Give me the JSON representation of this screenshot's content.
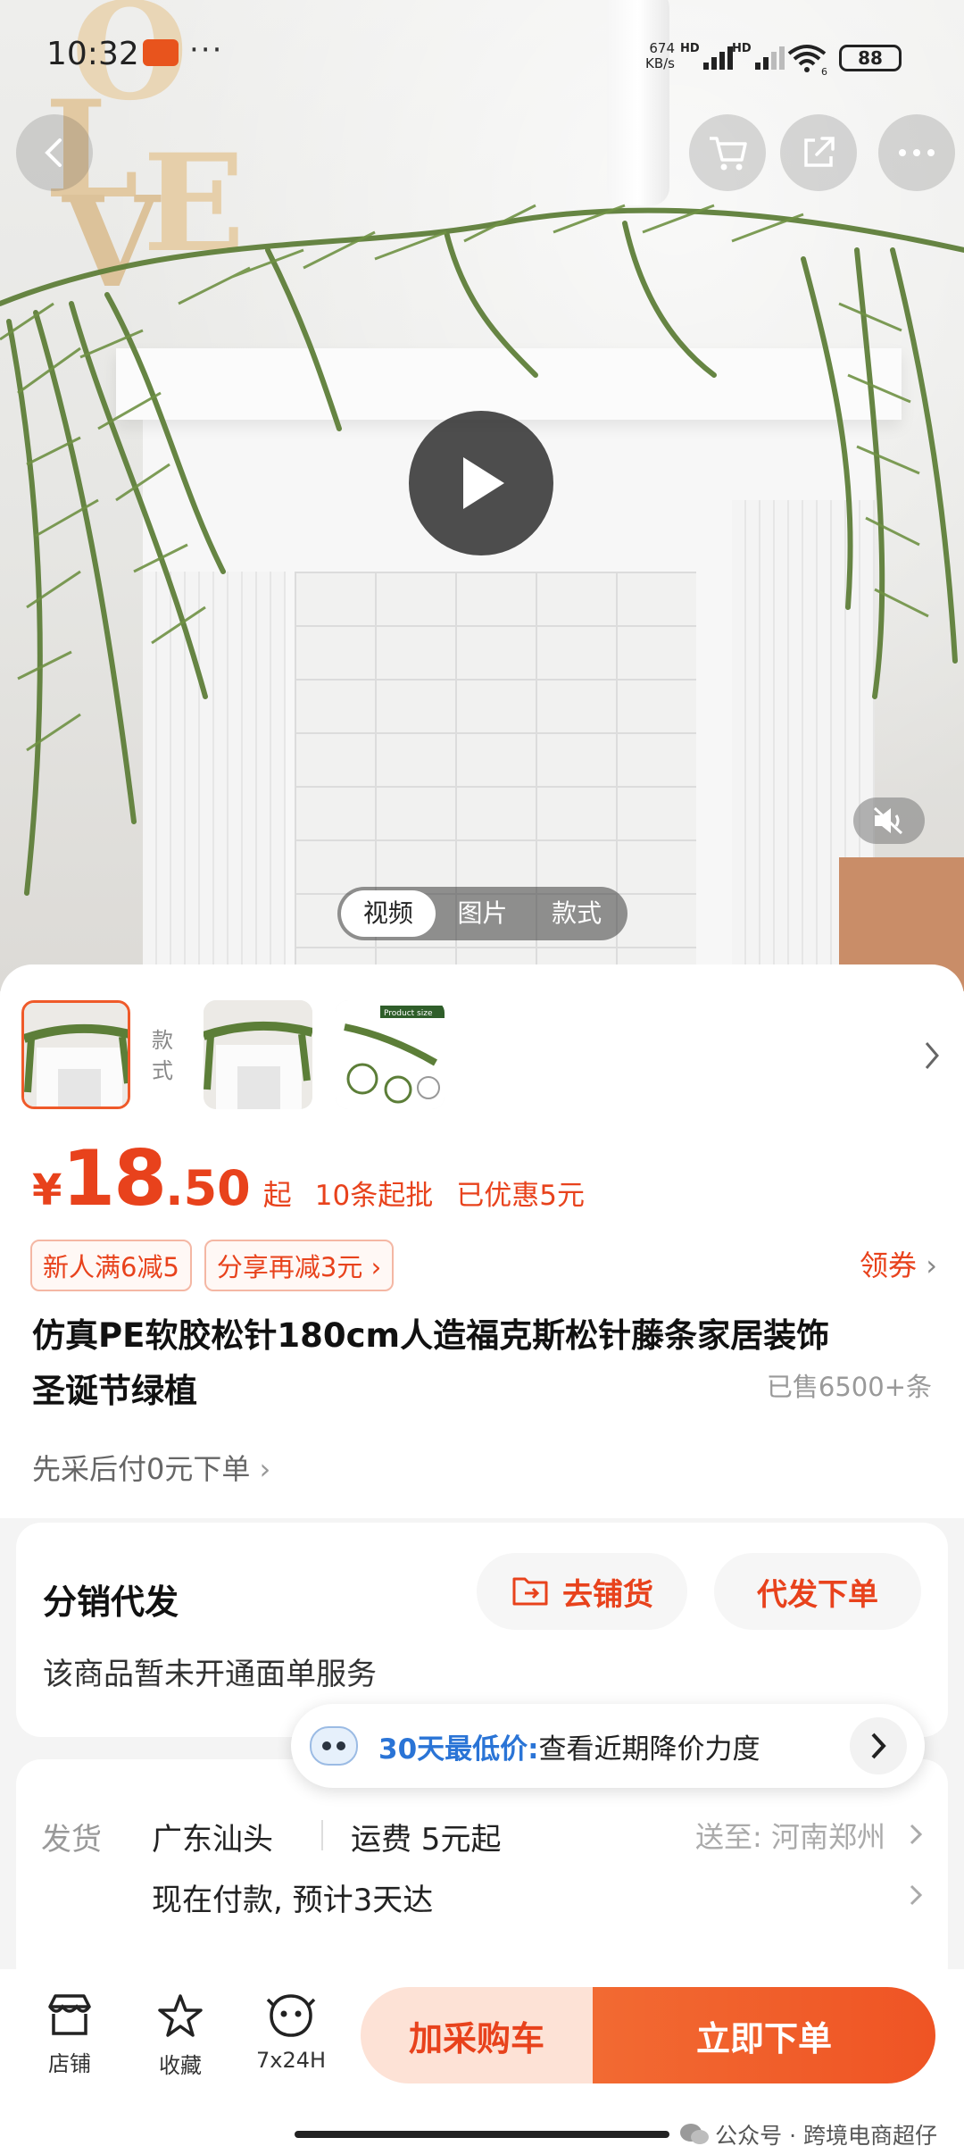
{
  "status_bar": {
    "time": "10:32",
    "more": "···",
    "net_speed_value": "674",
    "net_speed_unit": "KB/s",
    "sig1_label": "HD",
    "sig2_label": "HD",
    "sim_index": "6",
    "battery": "88"
  },
  "media": {
    "tabs": [
      "视频",
      "图片",
      "款式"
    ],
    "active_tab": "视频"
  },
  "thumbs": {
    "style_label": "款式",
    "product_size_text": "Product size"
  },
  "price": {
    "currency": "¥",
    "integer": "18",
    "decimal": ".50",
    "suffix": "起",
    "min_order": "10条起批",
    "discount": "已优惠5元"
  },
  "promo_tags": [
    "新人满6减5",
    "分享再减3元"
  ],
  "coupon_link": "领券",
  "title_line1": "仿真PE软胶松针180cm人造福克斯松针藤条家居装饰",
  "title_line2": "圣诞节绿植",
  "sold": "已售6500+条",
  "pay_later": "先采后付0元下单",
  "distribution": {
    "title": "分销代发",
    "subtitle": "该商品暂未开通面单服务",
    "stock_button": "去铺货",
    "dropship_button": "代发下单"
  },
  "lowest_price": {
    "label": "30天最低价:",
    "text": "查看近期降价力度"
  },
  "shipping": {
    "key": "发货",
    "from": "广东汕头",
    "fee": "运费 5元起",
    "to": "送至: 河南郑州",
    "eta": "现在付款, 预计3天达"
  },
  "bottom_bar": {
    "store": "店铺",
    "favorite": "收藏",
    "service": "7x24H",
    "add_cart": "加采购车",
    "buy_now": "立即下单"
  },
  "watermark": "公众号 · 跨境电商超仔",
  "colors": {
    "accent": "#e8421c",
    "blue_label": "#2a74d6"
  }
}
